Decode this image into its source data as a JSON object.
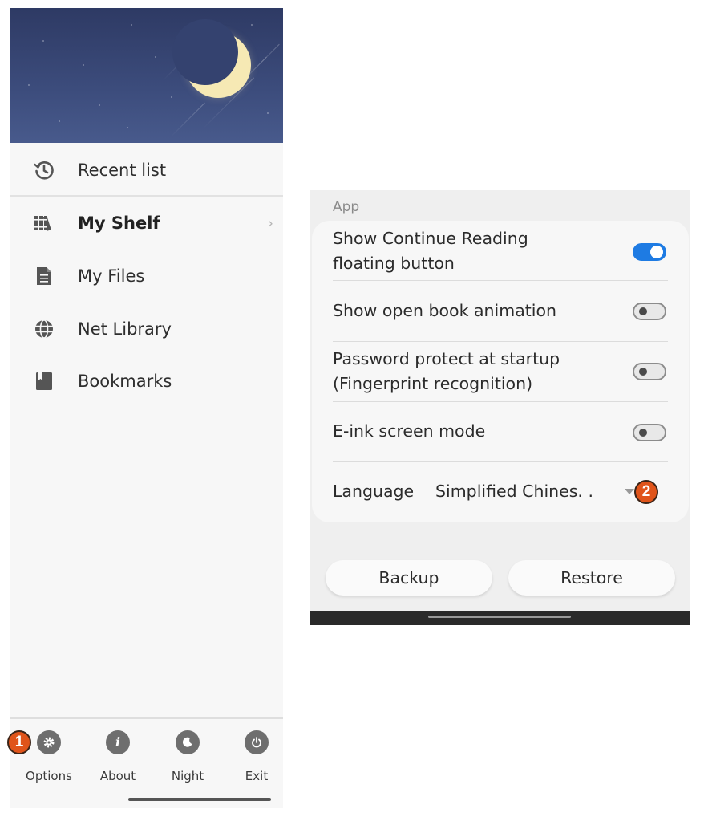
{
  "drawer": {
    "menu": [
      {
        "label": "Recent list",
        "icon": "history-icon"
      },
      {
        "label": "My Shelf",
        "icon": "bookshelf-icon",
        "chevron": "›"
      },
      {
        "label": "My Files",
        "icon": "file-icon"
      },
      {
        "label": "Net Library",
        "icon": "globe-icon"
      },
      {
        "label": "Bookmarks",
        "icon": "bookmark-icon"
      }
    ],
    "bottom": [
      {
        "label": "Options",
        "icon": "gear-icon"
      },
      {
        "label": "About",
        "icon": "info-icon"
      },
      {
        "label": "Night",
        "icon": "moon-icon"
      },
      {
        "label": "Exit",
        "icon": "power-icon"
      }
    ]
  },
  "callouts": {
    "one": "1",
    "two": "2"
  },
  "settings": {
    "section_label": "App",
    "rows": [
      {
        "label_line1": "Show Continue Reading",
        "label_line2": "floating button",
        "toggle": "on"
      },
      {
        "label_line1": "Show open book animation",
        "toggle": "off"
      },
      {
        "label_line1": "Password protect at startup",
        "label_line2": "(Fingerprint recognition)",
        "toggle": "off"
      },
      {
        "label_line1": "E-ink screen mode",
        "toggle": "off"
      }
    ],
    "language": {
      "label": "Language",
      "value": "Simplified Chines. ."
    },
    "backup_label": "Backup",
    "restore_label": "Restore"
  },
  "colors": {
    "accent": "#1e7be3",
    "callout": "#e0541a",
    "header_sky": "#3c4c7c",
    "moon": "#f6e9b4"
  }
}
